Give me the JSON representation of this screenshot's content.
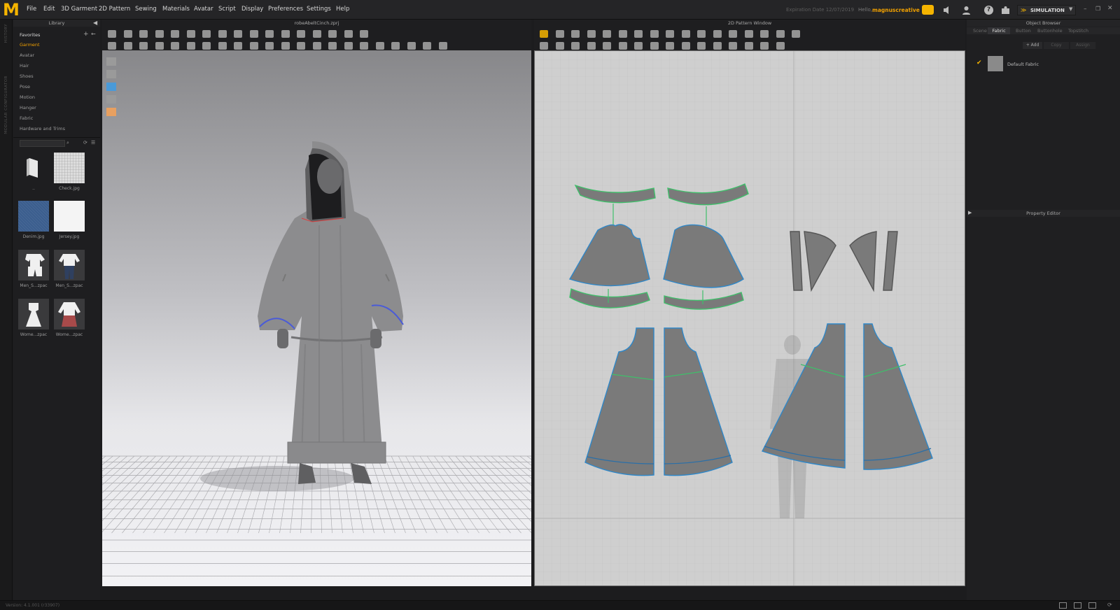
{
  "app": {
    "logo": "M",
    "menus": [
      "File",
      "Edit",
      "3D Garment",
      "2D Pattern",
      "Sewing",
      "Materials",
      "Avatar",
      "Script",
      "Display",
      "Preferences",
      "Settings",
      "Help"
    ],
    "expiration": "Expiration Date 12/07/2019",
    "hello": "Hello,",
    "username": "magnuscreative",
    "mode": "SIMULATION"
  },
  "side_tabs": [
    "HISTORY",
    "MODULAR CONFIGURATOR"
  ],
  "library": {
    "title": "Library",
    "favorites": "Favorites",
    "items": [
      "Garment",
      "Avatar",
      "Hair",
      "Shoes",
      "Pose",
      "Motion",
      "Hanger",
      "Fabric",
      "Hardware and Trims"
    ],
    "selected": "Garment",
    "thumbs": [
      "..",
      "Check.jpg",
      "Denim.jpg",
      "Jersey.jpg",
      "Men_S...zpac",
      "Men_S...zpac",
      "Wome...zpac",
      "Wome...zpac"
    ]
  },
  "view3d": {
    "title": "robeAbeltCinch.zprj"
  },
  "view2d": {
    "title": "2D Pattern Window"
  },
  "object_browser": {
    "title": "Object Browser",
    "tabs": [
      "Scene",
      "Fabric",
      "Button",
      "Buttonhole",
      "Topstitch"
    ],
    "active_tab": "Fabric",
    "actions": [
      "+ Add",
      "Copy",
      "Assign"
    ],
    "fabric": "Default Fabric"
  },
  "property_editor": {
    "title": "Property Editor"
  },
  "status": {
    "version": "Version: 4.1.001 (r33907)"
  },
  "colors": {
    "accent": "#f5b400",
    "pattern_fill": "#7a7a7a",
    "seam_green": "#3fbf6a",
    "seam_blue": "#2f87c8",
    "hem_blue": "#4a5bd8"
  }
}
